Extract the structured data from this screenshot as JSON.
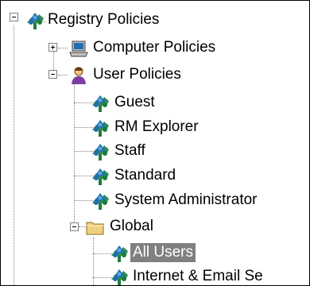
{
  "tree": {
    "root": {
      "label": "Registry Policies",
      "icon": "policy-tree-icon",
      "expanded": true
    },
    "computer_policies": {
      "label": "Computer Policies",
      "icon": "computer-icon",
      "expanded": false
    },
    "user_policies": {
      "label": "User Policies",
      "icon": "user-icon",
      "expanded": true,
      "children": [
        {
          "label": "Guest",
          "icon": "policy-tree-icon"
        },
        {
          "label": "RM Explorer",
          "icon": "policy-tree-icon"
        },
        {
          "label": "Staff",
          "icon": "policy-tree-icon"
        },
        {
          "label": "Standard",
          "icon": "policy-tree-icon"
        },
        {
          "label": "System Administrator",
          "icon": "policy-tree-icon"
        }
      ]
    },
    "global": {
      "label": "Global",
      "icon": "folder-icon",
      "expanded": true,
      "children": [
        {
          "label": "All Users",
          "icon": "policy-tree-icon",
          "selected": true
        },
        {
          "label": "Internet & Email Se",
          "icon": "policy-tree-icon"
        }
      ]
    }
  },
  "colors": {
    "selection": "#808080",
    "tree_line": "#808080",
    "folder": "#f0d080"
  }
}
